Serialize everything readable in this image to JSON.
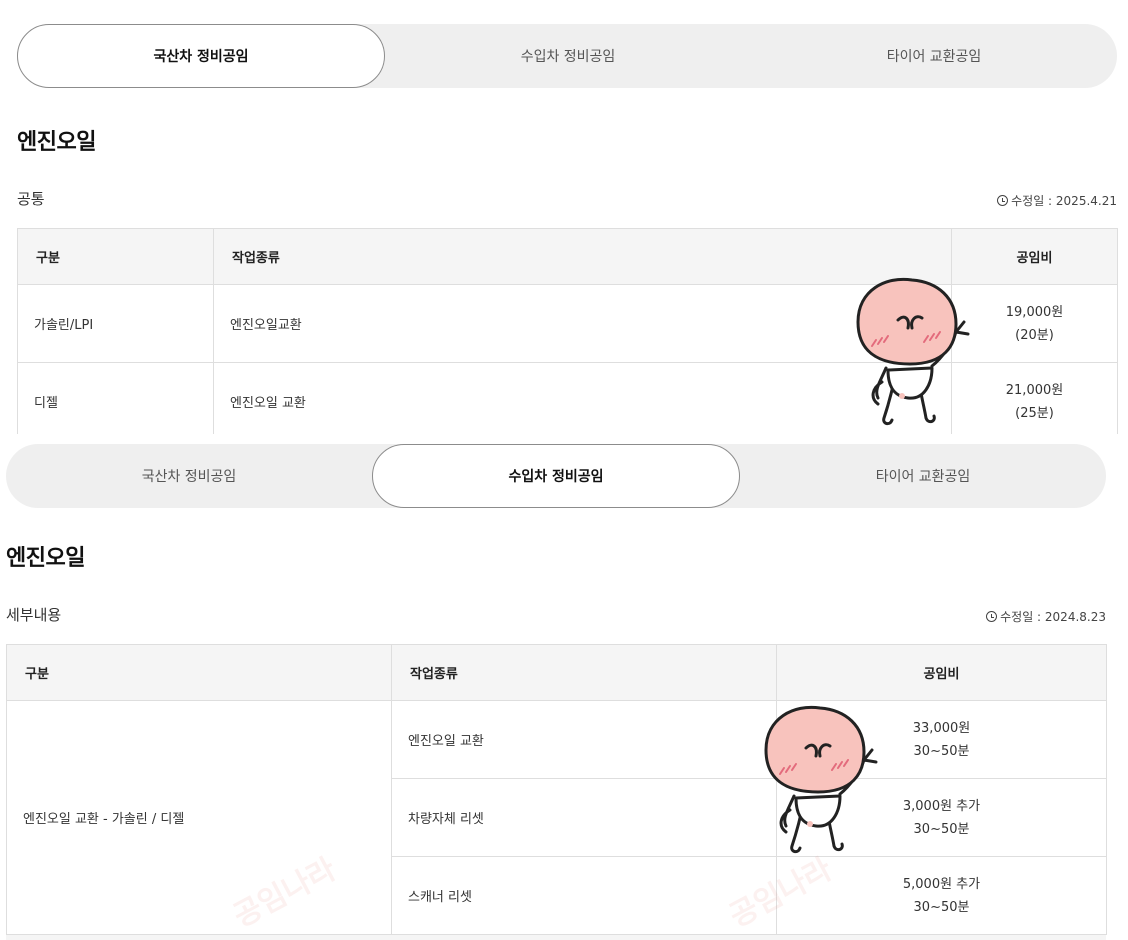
{
  "screen1": {
    "tabs": [
      "국산차 정비공임",
      "수입차 정비공임",
      "타이어 교환공임"
    ],
    "section_title": "엔진오일",
    "subsection": "공통",
    "updated": "수정일 : 2025.4.21",
    "table": {
      "headers": [
        "구분",
        "작업종류",
        "공임비"
      ],
      "rows": [
        {
          "category": "가솔린/LPI",
          "work": "엔진오일교환",
          "price": "19,000원",
          "time": "(20분)"
        },
        {
          "category": "디젤",
          "work": "엔진오일 교환",
          "price": "21,000원",
          "time": "(25분)"
        }
      ]
    }
  },
  "screen2": {
    "tabs": [
      "국산차 정비공임",
      "수입차 정비공임",
      "타이어 교환공임"
    ],
    "section_title": "엔진오일",
    "subsection": "세부내용",
    "updated": "수정일 : 2024.8.23",
    "table": {
      "headers": [
        "구분",
        "작업종류",
        "공임비"
      ],
      "category": "엔진오일 교환 - 가솔린 / 디젤",
      "rows": [
        {
          "work": "엔진오일 교환",
          "price": "33,000원",
          "time": "30~50분"
        },
        {
          "work": "차량자체 리셋",
          "price": "3,000원 추가",
          "time": "30~50분"
        },
        {
          "work": "스캐너 리셋",
          "price": "5,000원 추가",
          "time": "30~50분"
        }
      ]
    },
    "watermark": "공임나라"
  },
  "colors": {
    "tab_bg": "#efefef",
    "border": "#dedede",
    "header_bg": "#f5f5f5",
    "peach": "#f8c3bd"
  },
  "icons": [
    "clock-icon",
    "peach-character"
  ]
}
